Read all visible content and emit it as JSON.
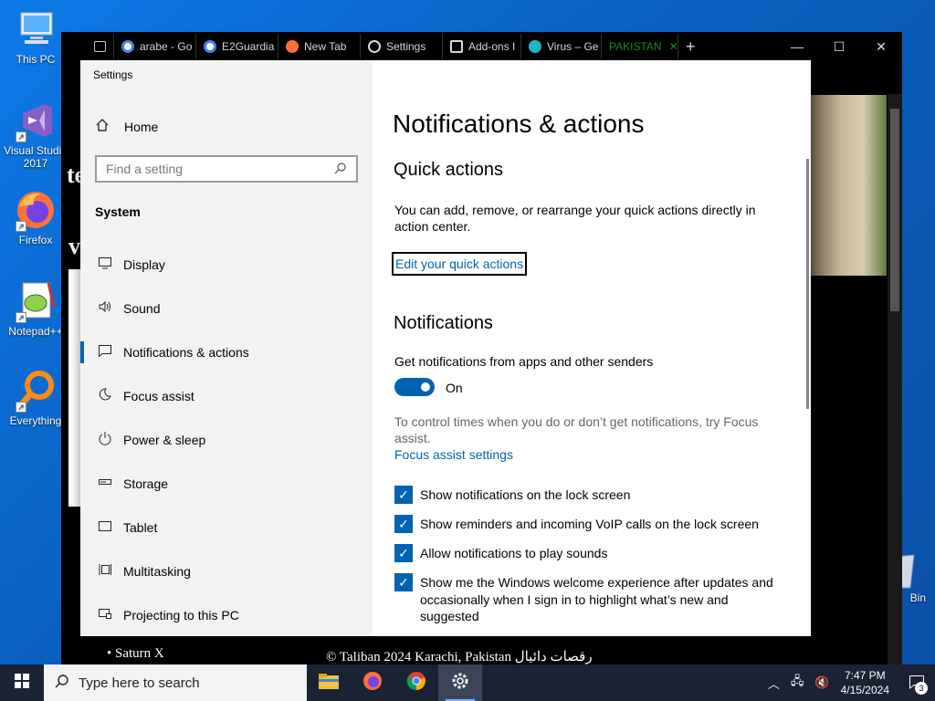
{
  "desktop": {
    "icons": [
      {
        "label": "This PC",
        "icon": "this-pc-icon"
      },
      {
        "label": "Visual Studio 2017",
        "icon": "visual-studio-icon"
      },
      {
        "label": "Firefox",
        "icon": "firefox-icon"
      },
      {
        "label": "Notepad++",
        "icon": "notepad-plus-plus-icon"
      },
      {
        "label": "Everything",
        "icon": "everything-search-icon"
      },
      {
        "label": "Bin",
        "icon": "recycle-bin-icon"
      }
    ]
  },
  "browser": {
    "tabs": [
      {
        "label": "arabe - Go",
        "icon": "google-icon"
      },
      {
        "label": "E2Guardia",
        "icon": "google-icon"
      },
      {
        "label": "New Tab",
        "icon": "firefox-icon"
      },
      {
        "label": "Settings",
        "icon": "gear-icon"
      },
      {
        "label": "Add-ons I",
        "icon": "puzzle-icon"
      },
      {
        "label": "Virus – Ge",
        "icon": "virus-icon"
      },
      {
        "label": "PAKISTAN",
        "icon": ""
      }
    ],
    "page_text_1": "te",
    "page_text_2": "v",
    "saturn": "Saturn X",
    "footer": "© Taliban 2024 Karachi, Pakistan رقصات دائيال"
  },
  "settings": {
    "window_title": "Settings",
    "nav": {
      "home": "Home",
      "search_placeholder": "Find a setting",
      "section": "System",
      "items": [
        {
          "label": "Display",
          "icon": "display-icon"
        },
        {
          "label": "Sound",
          "icon": "speaker-icon"
        },
        {
          "label": "Notifications & actions",
          "icon": "notification-icon",
          "active": true
        },
        {
          "label": "Focus assist",
          "icon": "moon-icon"
        },
        {
          "label": "Power & sleep",
          "icon": "power-icon"
        },
        {
          "label": "Storage",
          "icon": "storage-icon"
        },
        {
          "label": "Tablet",
          "icon": "tablet-icon"
        },
        {
          "label": "Multitasking",
          "icon": "multitasking-icon"
        },
        {
          "label": "Projecting to this PC",
          "icon": "projecting-icon"
        }
      ]
    },
    "content": {
      "title": "Notifications & actions",
      "quick_actions_heading": "Quick actions",
      "quick_actions_text": "You can add, remove, or rearrange your quick actions directly in action center.",
      "edit_quick_actions": "Edit your quick actions",
      "notifications_heading": "Notifications",
      "get_notifications_label": "Get notifications from apps and other senders",
      "toggle_state": "On",
      "focus_text": "To control times when you do or don’t get notifications, try Focus assist.",
      "focus_link": "Focus assist settings",
      "checkboxes": [
        {
          "label": "Show notifications on the lock screen",
          "checked": true
        },
        {
          "label": "Show reminders and incoming VoIP calls on the lock screen",
          "checked": true
        },
        {
          "label": "Allow notifications to play sounds",
          "checked": true
        },
        {
          "label": "Show me the Windows welcome experience after updates and occasionally when I sign in to highlight what’s new and suggested",
          "checked": true
        }
      ]
    }
  },
  "taskbar": {
    "search_placeholder": "Type here to search",
    "time": "7:47 PM",
    "date": "4/15/2024",
    "notification_count": "3"
  },
  "colors": {
    "accent": "#0063b1",
    "taskbar": "#1a2233",
    "nav_bg": "#f2f2f2"
  }
}
